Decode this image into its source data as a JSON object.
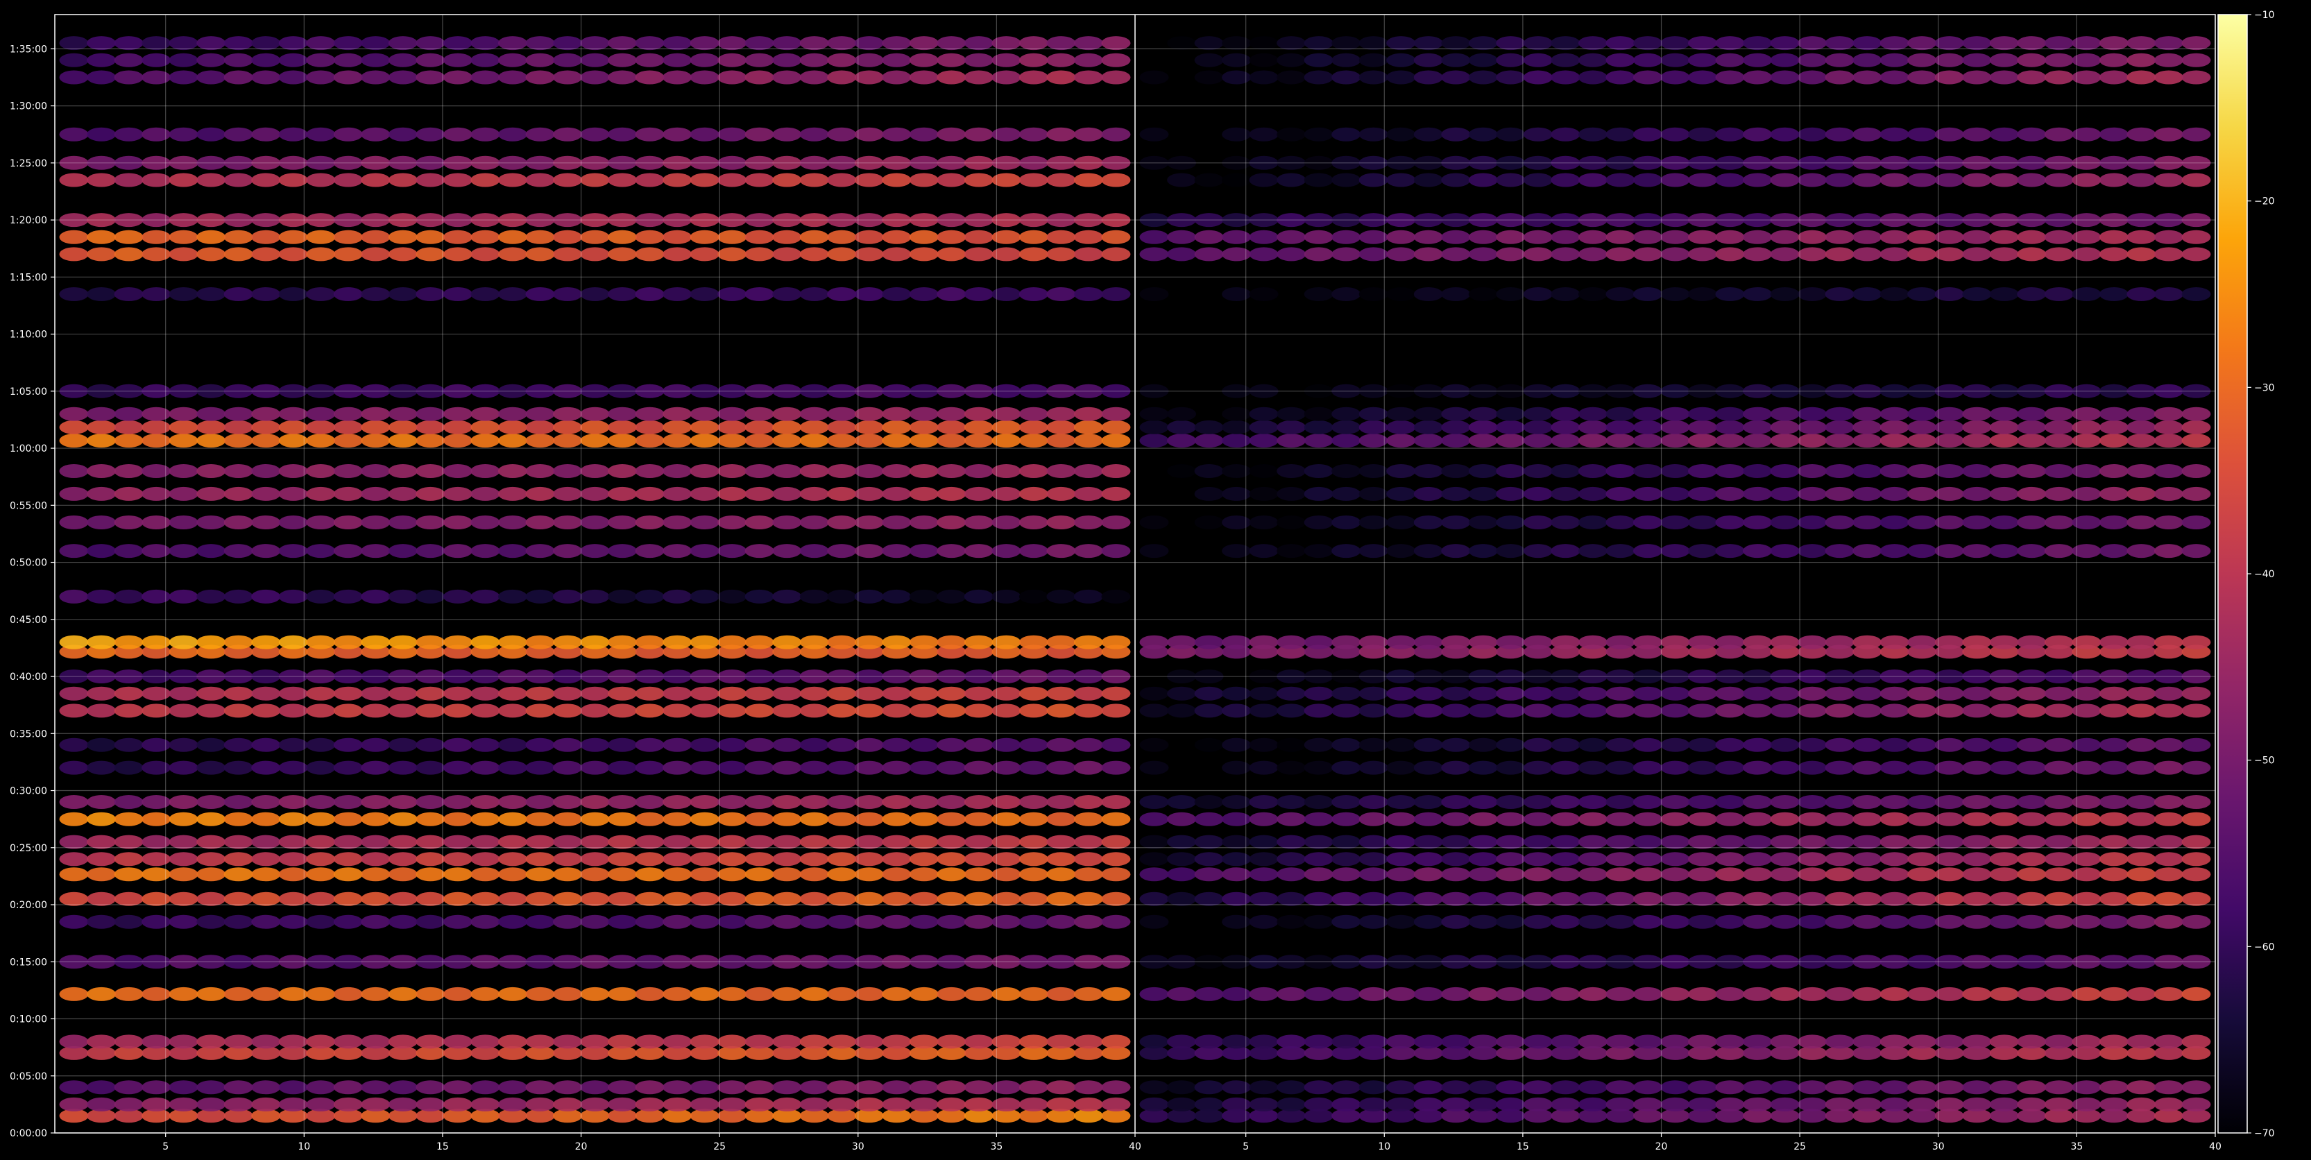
{
  "chart_data": {
    "type": "heatmap",
    "title": "",
    "xlabel": "",
    "ylabel": "",
    "colormap": "inferno",
    "background": "#000000",
    "grid": true,
    "colorbar": {
      "placement": "right",
      "range": [
        -70,
        -10
      ],
      "ticks": [
        {
          "value": -10,
          "label": "−10"
        },
        {
          "value": -20,
          "label": "−20"
        },
        {
          "value": -30,
          "label": "−30"
        },
        {
          "value": -40,
          "label": "−40"
        },
        {
          "value": -50,
          "label": "−50"
        },
        {
          "value": -60,
          "label": "−60"
        },
        {
          "value": -70,
          "label": "−70"
        }
      ]
    },
    "panels": [
      {
        "name": "left",
        "xlim": [
          1,
          40
        ],
        "xticks": [
          5,
          10,
          15,
          20,
          25,
          30,
          35,
          40
        ],
        "xtick_labels": [
          "5",
          "10",
          "15",
          "20",
          "25",
          "30",
          "35",
          "40"
        ],
        "ylim_seconds": [
          0,
          5880
        ],
        "series": [
          {
            "y": "0:01:30",
            "start": -36,
            "end": -26
          },
          {
            "y": "0:02:30",
            "start": -48,
            "end": -40
          },
          {
            "y": "0:04:00",
            "start": -55,
            "end": -46
          },
          {
            "y": "0:07:00",
            "start": -38,
            "end": -30
          },
          {
            "y": "0:08:00",
            "start": -44,
            "end": -36
          },
          {
            "y": "0:12:10",
            "start": -29,
            "end": -30
          },
          {
            "y": "0:15:00",
            "start": -56,
            "end": -50
          },
          {
            "y": "0:18:30",
            "start": -60,
            "end": -52
          },
          {
            "y": "0:20:30",
            "start": -36,
            "end": -30
          },
          {
            "y": "0:22:40",
            "start": -28,
            "end": -30
          },
          {
            "y": "0:24:00",
            "start": -40,
            "end": -34
          },
          {
            "y": "0:25:30",
            "start": -44,
            "end": -38
          },
          {
            "y": "0:27:30",
            "start": -26,
            "end": -30
          },
          {
            "y": "0:29:00",
            "start": -50,
            "end": -42
          },
          {
            "y": "0:32:00",
            "start": -62,
            "end": -52
          },
          {
            "y": "0:34:00",
            "start": -62,
            "end": -54
          },
          {
            "y": "0:37:00",
            "start": -40,
            "end": -34
          },
          {
            "y": "0:38:30",
            "start": -42,
            "end": -36
          },
          {
            "y": "0:40:00",
            "start": -58,
            "end": -52
          },
          {
            "y": "0:42:10",
            "start": -30,
            "end": -32
          },
          {
            "y": "0:43:00",
            "start": -22,
            "end": -28
          },
          {
            "y": "0:47:00",
            "start": -58,
            "end": -68
          },
          {
            "y": "0:51:00",
            "start": -56,
            "end": -50
          },
          {
            "y": "0:53:30",
            "start": -50,
            "end": -46
          },
          {
            "y": "0:56:00",
            "start": -46,
            "end": -40
          },
          {
            "y": "0:58:00",
            "start": -48,
            "end": -44
          },
          {
            "y": "1:00:40",
            "start": -28,
            "end": -30
          },
          {
            "y": "1:01:50",
            "start": -36,
            "end": -32
          },
          {
            "y": "1:03:00",
            "start": -50,
            "end": -44
          },
          {
            "y": "1:05:00",
            "start": -60,
            "end": -56
          },
          {
            "y": "1:13:30",
            "start": -62,
            "end": -58
          },
          {
            "y": "1:17:00",
            "start": -32,
            "end": -36
          },
          {
            "y": "1:18:30",
            "start": -30,
            "end": -34
          },
          {
            "y": "1:20:00",
            "start": -44,
            "end": -42
          },
          {
            "y": "1:23:30",
            "start": -42,
            "end": -36
          },
          {
            "y": "1:25:00",
            "start": -50,
            "end": -44
          },
          {
            "y": "1:27:30",
            "start": -56,
            "end": -48
          },
          {
            "y": "1:32:30",
            "start": -56,
            "end": -42
          },
          {
            "y": "1:34:00",
            "start": -58,
            "end": -46
          },
          {
            "y": "1:35:30",
            "start": -60,
            "end": -48
          }
        ]
      },
      {
        "name": "right",
        "xlim": [
          1,
          40
        ],
        "xticks": [
          5,
          10,
          15,
          20,
          25,
          30,
          35,
          40
        ],
        "xtick_labels": [
          "5",
          "10",
          "15",
          "20",
          "25",
          "30",
          "35",
          "40"
        ],
        "ylim_seconds": [
          0,
          5880
        ],
        "series": [
          {
            "y": "0:01:30",
            "start": -62,
            "end": -42
          },
          {
            "y": "0:02:30",
            "start": -64,
            "end": -44
          },
          {
            "y": "0:04:00",
            "start": -66,
            "end": -46
          },
          {
            "y": "0:07:00",
            "start": -60,
            "end": -38
          },
          {
            "y": "0:08:00",
            "start": -62,
            "end": -42
          },
          {
            "y": "0:12:10",
            "start": -56,
            "end": -36
          },
          {
            "y": "0:15:00",
            "start": -68,
            "end": -52
          },
          {
            "y": "0:18:30",
            "start": -70,
            "end": -48
          },
          {
            "y": "0:20:30",
            "start": -64,
            "end": -34
          },
          {
            "y": "0:22:40",
            "start": -56,
            "end": -36
          },
          {
            "y": "0:24:00",
            "start": -66,
            "end": -38
          },
          {
            "y": "0:25:30",
            "start": -66,
            "end": -42
          },
          {
            "y": "0:27:30",
            "start": -56,
            "end": -38
          },
          {
            "y": "0:29:00",
            "start": -66,
            "end": -48
          },
          {
            "y": "0:32:00",
            "start": -70,
            "end": -50
          },
          {
            "y": "0:34:00",
            "start": -70,
            "end": -52
          },
          {
            "y": "0:37:00",
            "start": -66,
            "end": -40
          },
          {
            "y": "0:38:30",
            "start": -66,
            "end": -44
          },
          {
            "y": "0:40:00",
            "start": -70,
            "end": -54
          },
          {
            "y": "0:42:10",
            "start": -50,
            "end": -38
          },
          {
            "y": "0:43:00",
            "start": -52,
            "end": -40
          },
          {
            "y": "0:51:00",
            "start": -70,
            "end": -50
          },
          {
            "y": "0:53:30",
            "start": -70,
            "end": -50
          },
          {
            "y": "0:56:00",
            "start": -70,
            "end": -44
          },
          {
            "y": "0:58:00",
            "start": -70,
            "end": -48
          },
          {
            "y": "1:00:40",
            "start": -58,
            "end": -40
          },
          {
            "y": "1:01:50",
            "start": -66,
            "end": -44
          },
          {
            "y": "1:03:00",
            "start": -70,
            "end": -48
          },
          {
            "y": "1:05:00",
            "start": -70,
            "end": -60
          },
          {
            "y": "1:13:30",
            "start": -70,
            "end": -62
          },
          {
            "y": "1:17:00",
            "start": -54,
            "end": -40
          },
          {
            "y": "1:18:30",
            "start": -54,
            "end": -42
          },
          {
            "y": "1:20:00",
            "start": -62,
            "end": -50
          },
          {
            "y": "1:23:30",
            "start": -70,
            "end": -44
          },
          {
            "y": "1:25:00",
            "start": -70,
            "end": -48
          },
          {
            "y": "1:27:30",
            "start": -70,
            "end": -50
          },
          {
            "y": "1:32:30",
            "start": -70,
            "end": -42
          },
          {
            "y": "1:34:00",
            "start": -70,
            "end": -46
          },
          {
            "y": "1:35:30",
            "start": -70,
            "end": -48
          }
        ]
      }
    ],
    "yticks": [
      {
        "seconds": 0,
        "label": "0:00:00"
      },
      {
        "seconds": 300,
        "label": "0:05:00"
      },
      {
        "seconds": 600,
        "label": "0:10:00"
      },
      {
        "seconds": 900,
        "label": "0:15:00"
      },
      {
        "seconds": 1200,
        "label": "0:20:00"
      },
      {
        "seconds": 1500,
        "label": "0:25:00"
      },
      {
        "seconds": 1800,
        "label": "0:30:00"
      },
      {
        "seconds": 2100,
        "label": "0:35:00"
      },
      {
        "seconds": 2400,
        "label": "0:40:00"
      },
      {
        "seconds": 2700,
        "label": "0:45:00"
      },
      {
        "seconds": 3000,
        "label": "0:50:00"
      },
      {
        "seconds": 3300,
        "label": "0:55:00"
      },
      {
        "seconds": 3600,
        "label": "1:00:00"
      },
      {
        "seconds": 3900,
        "label": "1:05:00"
      },
      {
        "seconds": 4200,
        "label": "1:10:00"
      },
      {
        "seconds": 4500,
        "label": "1:15:00"
      },
      {
        "seconds": 4800,
        "label": "1:20:00"
      },
      {
        "seconds": 5100,
        "label": "1:25:00"
      },
      {
        "seconds": 5400,
        "label": "1:30:00"
      },
      {
        "seconds": 5700,
        "label": "1:35:00"
      }
    ]
  }
}
